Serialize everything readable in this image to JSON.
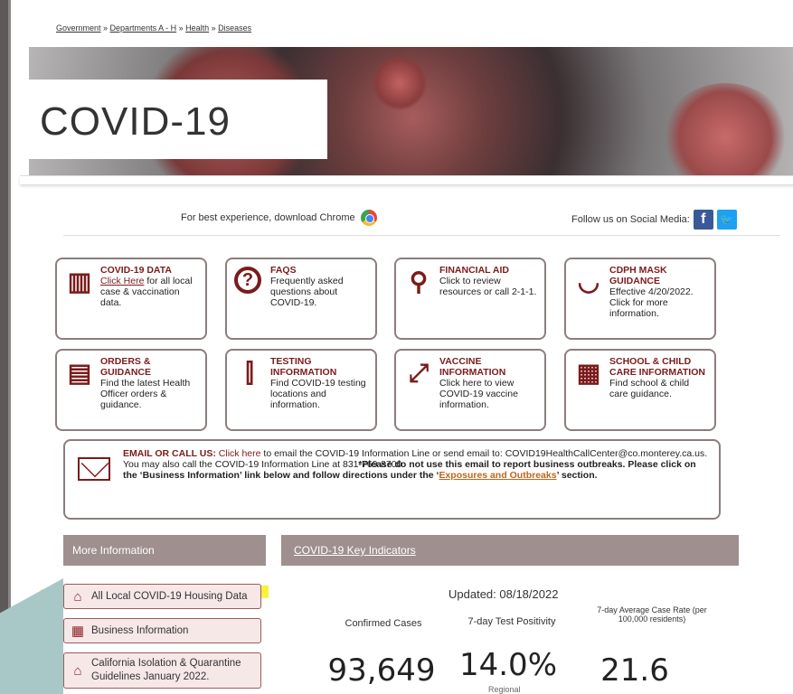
{
  "breadcrumbs": [
    "Government",
    "Departments A - H",
    "Health",
    "Diseases"
  ],
  "breadcrumb_sep": " » ",
  "hero": {
    "title": "COVID-19"
  },
  "top": {
    "chrome_text": "For best experience, download Chrome",
    "social_text": "Follow us on Social Media:",
    "fb_glyph": "f",
    "tw_glyph": "🐦"
  },
  "cards": [
    {
      "title": "COVID-19 DATA",
      "link": "Click Here",
      "text": " for all local case & vaccination data.",
      "icon": "chart-icon"
    },
    {
      "title": "FAQS",
      "text": "Frequently asked questions about COVID-19.",
      "icon": "question-icon"
    },
    {
      "title": "FINANCIAL AID",
      "text": "Click to review resources or call 2-1-1.",
      "icon": "search-icon"
    },
    {
      "title": "CDPH MASK GUIDANCE",
      "text": "Effective 4/20/2022. Click for more information.",
      "icon": "mask-icon"
    },
    {
      "title": "ORDERS & GUIDANCE",
      "text": "Find the latest Health Officer orders & guidance.",
      "icon": "document-icon"
    },
    {
      "title": "TESTING INFORMATION",
      "text": "Find COVID-19 testing locations and information.",
      "icon": "test-tube-icon"
    },
    {
      "title": "VACCINE INFORMATION",
      "text": "Click here to view COVID-19 vaccine information.",
      "icon": "syringe-icon"
    },
    {
      "title": "SCHOOL & CHILD CARE INFORMATION",
      "text": "Find school & child care guidance.",
      "icon": "school-icon"
    }
  ],
  "email": {
    "label": "EMAIL OR CALL US:",
    "link": "Click here",
    "p1": " to email the COVID-19 Information Line or send email to: COVID19HealthCallCenter@co.monterey.ca.us. You may also call the COVID-19 Information Line at 831-769-8700. ",
    "bold1": "*Please do not use this email to report business outbreaks. Please click on the ‘Business Information’ link below and follow directions under the ‘",
    "outbreaks": "Exposures and Outbreaks",
    "bold2": "’ section."
  },
  "sidebar": {
    "heading": "More Information",
    "items": [
      {
        "label": "All Local COVID-19 Housing Data",
        "icon": "house-icon"
      },
      {
        "label": "Business Information",
        "icon": "building-icon"
      },
      {
        "label": "California Isolation & Quarantine Guidelines January 2022.",
        "icon": "home-icon"
      }
    ]
  },
  "indicators": {
    "heading": "COVID-19 Key Indicators",
    "updated": "Updated: 08/18/2022",
    "labels": [
      "Confirmed Cases",
      "7-day Test Positivity",
      "7-day Average Case Rate (per 100,000 residents)"
    ],
    "values": [
      "93,649",
      "14.0%",
      "21.6"
    ],
    "sub": "Regional"
  },
  "colors": {
    "accent": "#7b1b1b",
    "header_bg": "#a08f8f",
    "highlight": "#f8f018"
  }
}
